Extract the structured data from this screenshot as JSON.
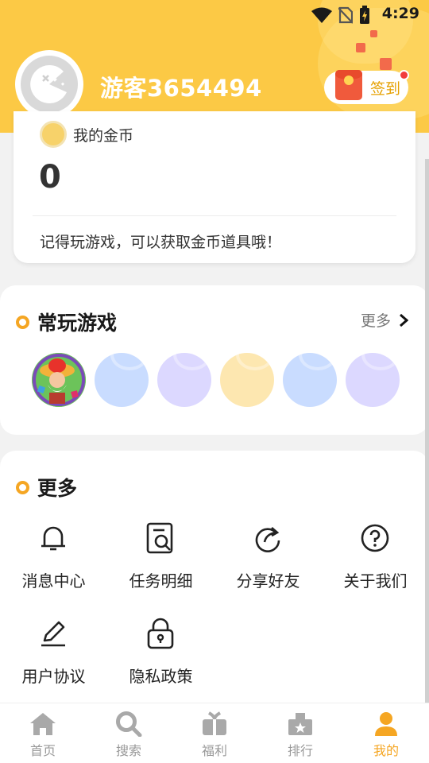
{
  "status_bar": {
    "time": "4:29"
  },
  "header": {
    "username": "游客3654494",
    "signin_label": "签到"
  },
  "coin_card": {
    "title": "我的金币",
    "value": "0",
    "tip": "记得玩游戏，可以获取金币道具哦！"
  },
  "recent_games": {
    "title": "常玩游戏",
    "more_label": "更多",
    "placeholder_colors": [
      "#c9dcff",
      "#dcd8ff",
      "#fde7b0",
      "#c9dcff",
      "#dcd8ff"
    ]
  },
  "more_section": {
    "title": "更多",
    "items": [
      {
        "label": "消息中心",
        "icon": "bell-icon"
      },
      {
        "label": "任务明细",
        "icon": "task-detail-icon"
      },
      {
        "label": "分享好友",
        "icon": "share-icon"
      },
      {
        "label": "关于我们",
        "icon": "help-icon"
      },
      {
        "label": "用户协议",
        "icon": "edit-icon"
      },
      {
        "label": "隐私政策",
        "icon": "lock-icon"
      }
    ]
  },
  "tabbar": {
    "items": [
      {
        "label": "首页",
        "icon": "home-icon"
      },
      {
        "label": "搜索",
        "icon": "search-icon"
      },
      {
        "label": "福利",
        "icon": "gift-icon"
      },
      {
        "label": "排行",
        "icon": "ranking-icon"
      },
      {
        "label": "我的",
        "icon": "user-icon"
      }
    ],
    "active_index": 4
  },
  "colors": {
    "brand_yellow": "#fcc945",
    "accent_orange": "#f5a623",
    "inactive_gray": "#999999"
  }
}
